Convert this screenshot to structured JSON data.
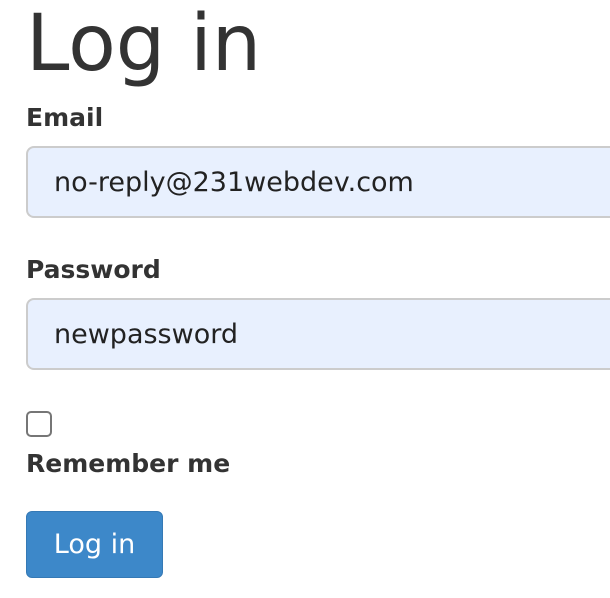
{
  "page_title": "Log in",
  "form": {
    "email_label": "Email",
    "email_value": "no-reply@231webdev.com",
    "password_label": "Password",
    "password_value": "newpassword",
    "remember_label": "Remember me",
    "remember_checked": false,
    "submit_label": "Log in"
  },
  "colors": {
    "button": "#3d88c9",
    "input_bg": "#e8f0fe"
  }
}
